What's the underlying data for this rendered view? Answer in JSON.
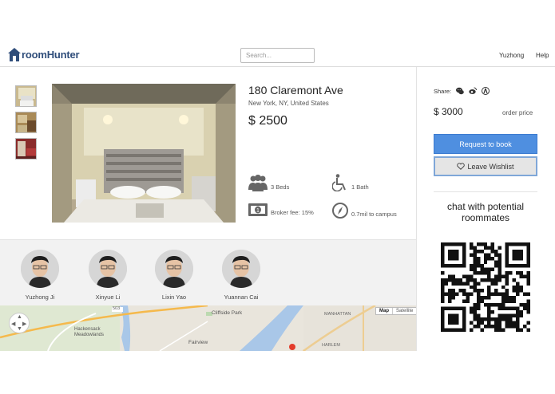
{
  "navbar": {
    "brand": "roomHunter",
    "search_placeholder": "Search...",
    "user": "Yuzhong",
    "help": "Help"
  },
  "listing": {
    "title": "180 Claremont Ave",
    "location": "New York, NY, United States",
    "price": "$ 2500",
    "features": {
      "beds": "3 Beds",
      "bath": "1 Bath",
      "broker": "Broker fee: 15%",
      "distance": "0.7mil to campus"
    }
  },
  "roommates": [
    {
      "name": "Yuzhong Ji"
    },
    {
      "name": "Xinyue Li"
    },
    {
      "name": "Lixin Yao"
    },
    {
      "name": "Yuannan Cai"
    }
  ],
  "map": {
    "map_tab": "Map",
    "satellite_tab": "Satellite",
    "labels": {
      "cliffside": "Cliffside Park",
      "fairview": "Fairview",
      "hackensack": "Hackensack Meadowlands",
      "manhattan": "MANHATTAN",
      "harlem": "HARLEM",
      "route": "503"
    }
  },
  "sidebar": {
    "share_label": "Share:",
    "price": "$ 3000",
    "order_label": "order price",
    "request_button": "Request to book",
    "wishlist_button": "Leave Wishlist",
    "chat_title": "chat with potential roommates"
  },
  "colors": {
    "brand": "#2f4d7a",
    "primary_button": "#4f8fe0",
    "roommates_bg": "#f2f2f2"
  }
}
